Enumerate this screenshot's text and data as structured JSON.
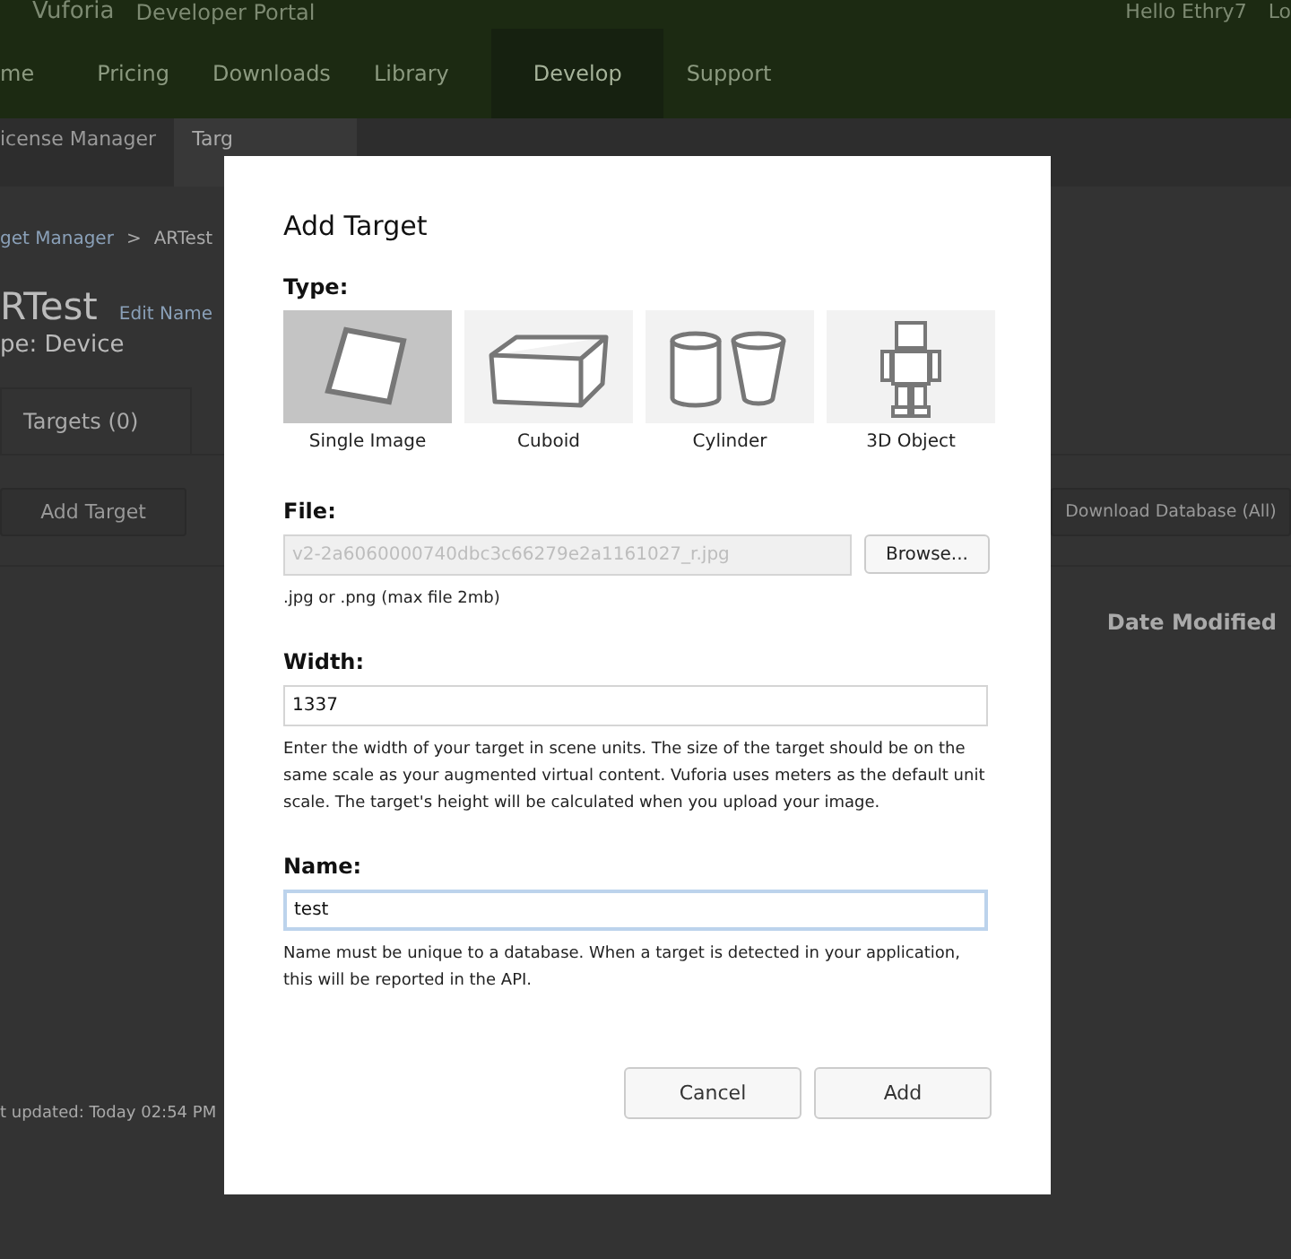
{
  "header": {
    "logo": "Vuforia",
    "portal": "Developer Portal",
    "greeting": "Hello Ethry7",
    "logout": "Lo"
  },
  "nav": [
    {
      "label": "me",
      "selected": false
    },
    {
      "label": "Pricing",
      "selected": false
    },
    {
      "label": "Downloads",
      "selected": false
    },
    {
      "label": "Library",
      "selected": false
    },
    {
      "label": "Develop",
      "selected": true
    },
    {
      "label": "Support",
      "selected": false
    }
  ],
  "subnav": [
    {
      "label": "icense Manager",
      "selected": false
    },
    {
      "label": "Targ",
      "selected": true
    }
  ],
  "breadcrumb": {
    "parent": "get Manager",
    "separator": ">",
    "current": "ARTest"
  },
  "database": {
    "title": "RTest",
    "edit_link": "Edit Name",
    "type": "pe: Device"
  },
  "tabs": [
    {
      "label": "Targets (0)",
      "selected": true
    }
  ],
  "add_target_button": "Add Target",
  "download_button": "Download Database (All)",
  "column_header": "Date Modified",
  "last_updated": "t updated: Today 02:54 PM",
  "dialog": {
    "title": "Add Target",
    "type_label": "Type:",
    "types": [
      {
        "kind": "image",
        "label": "Single Image",
        "selected": true
      },
      {
        "kind": "cuboid",
        "label": "Cuboid",
        "selected": false
      },
      {
        "kind": "cylinder",
        "label": "Cylinder",
        "selected": false
      },
      {
        "kind": "object",
        "label": "3D Object",
        "selected": false
      }
    ],
    "file_label": "File:",
    "file_value": "v2-2a6060000740dbc3c66279e2a1161027_r.jpg",
    "browse_button": "Browse...",
    "file_hint": ".jpg or .png (max file 2mb)",
    "width_label": "Width:",
    "width_value": "1337",
    "width_hint": "Enter the width of your target in scene units. The size of the target should be on the same scale as your augmented virtual content. Vuforia uses meters as the default unit scale. The target's height will be calculated when you upload your image.",
    "name_label": "Name:",
    "name_value": "test",
    "name_focused": true,
    "name_hint": "Name must be unique to a database. When a target is detected in your application, this will be reported in the API.",
    "buttons": [
      "Cancel",
      "Add"
    ]
  }
}
